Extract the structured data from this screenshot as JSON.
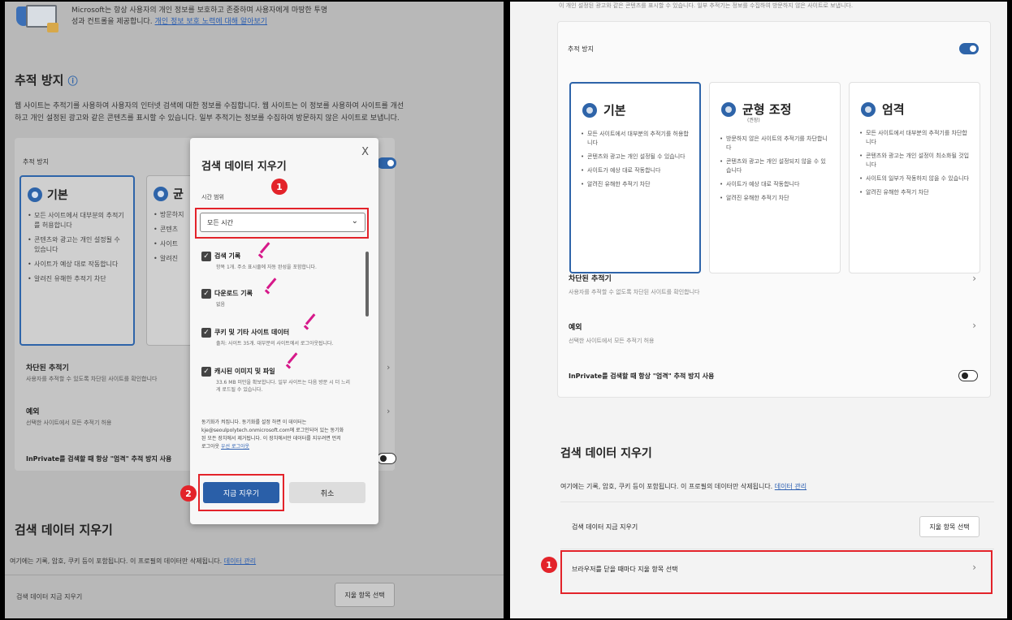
{
  "left": {
    "banner_text": "Microsoft는 항상 사용자의 개인 정보를 보호하고 존중하며 사용자에게 마땅한 투명",
    "banner_text2": "성과 컨트롤을 제공합니다.",
    "banner_link": "개인 정보 보호 노력에 대해 알아보기",
    "tracking_heading": "추적 방지",
    "tracking_desc": "웹 사이트는 추적기를 사용하여 사용자의 인터넷 검색에 대한 정보를 수집합니다. 웹 사이트는 이 정보를 사용하여 사이트를 개선",
    "tracking_desc2": "하고 개인 설정된 광고와 같은 콘텐츠를 표시할 수 있습니다. 일부 추적기는 정보를 수집하여 방문하지 않은 사이트로 보냅니다.",
    "tracking_label": "추적 방지",
    "card_basic_title": "기본",
    "card_balanced_title": "균",
    "card_basic_items": [
      "모든 사이트에서 대부분의 추적기를 허용합니다",
      "콘텐츠와 광고는 개인 설정될 수 있습니다",
      "사이트가 예상 대로 작동합니다",
      "알려진 유해한 추적기 차단"
    ],
    "card_balanced_items": [
      "방문하지",
      "콘텐츠",
      "사이트",
      "알려진"
    ],
    "blocked_title": "차단된 추적기",
    "blocked_sub": "사용자를 추적할 수 있도록 차단된 사이트를 확인합니다",
    "exceptions_title": "예외",
    "exceptions_sub": "선택한 사이트에서 모든 추적기 허용",
    "inprivate": "InPrivate를 검색할 때 항상 \"엄격\" 추적 방지 사용",
    "clear_heading": "검색 데이터 지우기",
    "clear_desc": "여기에는 기록, 암호, 쿠키 등이 포함됩니다. 이 프로필의 데이터만 삭제됩니다.",
    "clear_link": "데이터 관리",
    "clear_now": "검색 데이터 지금 지우기",
    "choose_btn": "지울 항목 선택"
  },
  "dialog": {
    "title": "검색 데이터 지우기",
    "close": "X",
    "range_label": "시간 범위",
    "range_value": "모든 시간",
    "items": [
      {
        "label": "검색 기록",
        "sub": "항목 1개. 주소 표시줄에 자동 완성을 포함합니다."
      },
      {
        "label": "다운로드 기록",
        "sub": "없음"
      },
      {
        "label": "쿠키 및 기타 사이트 데이터",
        "sub": "출처: 사이트 35개. 대부분의 사이트에서 로그아웃됩니다."
      },
      {
        "label": "캐시된 이미지 및 파일",
        "sub": "33.6 MB 미만을 확보합니다. 일부 사이트는 다음 방문 시 더 느리게 로드될 수 있습니다."
      }
    ],
    "note": "동기화가 켜집니다. 동기화를 설정 하면 이 데이터는",
    "note2": "kje@seoulpolytech.onmicrosoft.com에 로그인되어 있는 동기화",
    "note3": "된 모든 장치에서 제거됩니다. 이 장치에서만 데이터를 지우려면 먼저",
    "note4": "로그아웃",
    "note_link": "우선 로그아웃",
    "clear_btn": "지금 지우기",
    "cancel_btn": "취소",
    "badge1": "1",
    "badge2": "2"
  },
  "right": {
    "top_cut": "이 개인 설정된 광고와 같은 콘텐츠를 표시할 수 있습니다. 일부 추적기는 정보를 수집하여 방문하지 않은 사이트로 보냅니다.",
    "tracking_label": "추적 방지",
    "cards": [
      {
        "title": "기본",
        "sub": "",
        "items": [
          "모든 사이트에서 대부분의 추적기를 허용합니다",
          "콘텐츠와 광고는 개인 설정될 수 있습니다",
          "사이트가 예상 대로 작동합니다",
          "알려진 유해한 추적기 차단"
        ]
      },
      {
        "title": "균형 조정",
        "sub": "(권장)",
        "items": [
          "방문하지 않은 사이트의 추적기를 차단합니다",
          "콘텐츠와 광고는 개인 설정되지 않을 수 있습니다",
          "사이트가 예상 대로 작동합니다",
          "알려진 유해한 추적기 차단"
        ]
      },
      {
        "title": "엄격",
        "sub": "",
        "items": [
          "모든 사이트에서 대부분의 추적기를 차단합니다",
          "콘텐츠와 광고는 개인 설정이 최소화될 것입니다",
          "사이트의 일부가 작동하지 않을 수 있습니다",
          "알려진 유해한 추적기 차단"
        ]
      }
    ],
    "blocked_title": "차단된 추적기",
    "blocked_sub": "사용자를 추적할 수 없도록 차단된 사이트를 확인합니다",
    "exceptions_title": "예외",
    "exceptions_sub": "선택한 사이트에서 모든 추적기 허용",
    "inprivate": "InPrivate를 검색할 때 항상 \"엄격\" 추적 방지 사용",
    "clear_heading": "검색 데이터 지우기",
    "clear_desc": "여기에는 기록, 암호, 쿠키 등이 포함됩니다. 이 프로필의 데이터만 삭제됩니다.",
    "clear_link": "데이터 관리",
    "clear_now": "검색 데이터 지금 지우기",
    "choose_btn": "지울 항목 선택",
    "on_close": "브라우저를 닫을 때마다 지울 항목 선택",
    "badge1": "1"
  },
  "colors": {
    "accent": "#2e64a9",
    "annotation": "#e3232a",
    "check": "#d6198a"
  }
}
